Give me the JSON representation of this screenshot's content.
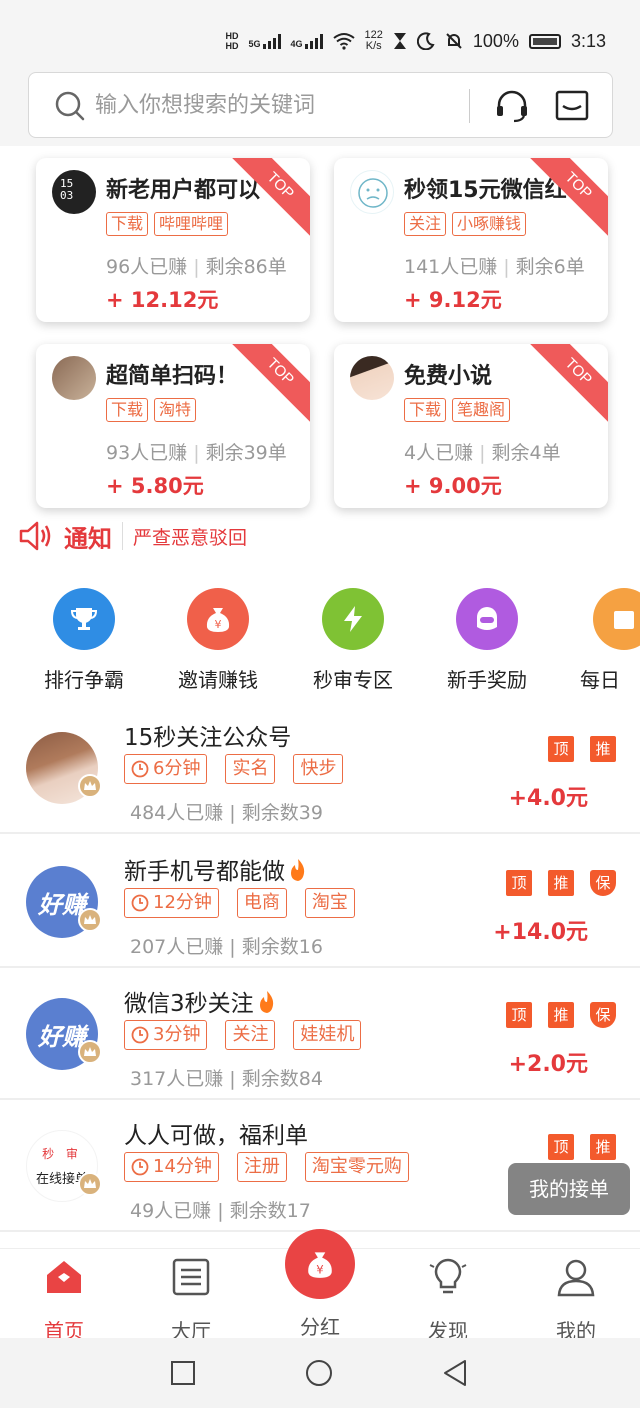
{
  "status_bar": {
    "network": "5G",
    "network2": "4G",
    "speed_value": "122",
    "speed_unit": "K/s",
    "battery": "100%",
    "time": "3:13"
  },
  "search": {
    "placeholder": "输入你想搜索的关键词"
  },
  "top_cards": [
    {
      "title": "新老用户都可以",
      "tags": [
        "下载",
        "哔哩哔哩"
      ],
      "earned": "96人已赚",
      "remaining": "剩余86单",
      "reward": "+ 12.12元",
      "ribbon": "TOP"
    },
    {
      "title": "秒领15元微信红",
      "tags": [
        "关注",
        "小啄赚钱"
      ],
      "earned": "141人已赚",
      "remaining": "剩余6单",
      "reward": "+ 9.12元",
      "ribbon": "TOP"
    },
    {
      "title": "超简单扫码！",
      "tags": [
        "下载",
        "淘特"
      ],
      "earned": "93人已赚",
      "remaining": "剩余39单",
      "reward": "+ 5.80元",
      "ribbon": "TOP"
    },
    {
      "title": "免费小说",
      "tags": [
        "下载",
        "笔趣阁"
      ],
      "earned": "4人已赚",
      "remaining": "剩余4单",
      "reward": "+ 9.00元",
      "ribbon": "TOP"
    }
  ],
  "card_avatar_text": "15\n03",
  "notice": {
    "label": "通知",
    "text": "严查恶意驳回"
  },
  "categories": [
    {
      "label": "排行争霸",
      "color": "#2f8de4"
    },
    {
      "label": "邀请赚钱",
      "color": "#f0604a"
    },
    {
      "label": "秒审专区",
      "color": "#7fc234"
    },
    {
      "label": "新手奖励",
      "color": "#b05be0"
    },
    {
      "label": "每日",
      "color": "#f5a142"
    }
  ],
  "tasks": [
    {
      "title": "15秒关注公众号",
      "time": "6分钟",
      "tags": [
        "实名",
        "快步"
      ],
      "stats": "484人已赚 | 剩余数39",
      "badges": [
        "顶",
        "推"
      ],
      "reward": "+4.0元",
      "hot": false
    },
    {
      "title": "新手机号都能做",
      "time": "12分钟",
      "tags": [
        "电商",
        "淘宝"
      ],
      "stats": "207人已赚 | 剩余数16",
      "badges": [
        "顶",
        "推",
        "保"
      ],
      "reward": "+14.0元",
      "hot": true,
      "avatar_text": "好赚"
    },
    {
      "title": "微信3秒关注",
      "time": "3分钟",
      "tags": [
        "关注",
        "娃娃机"
      ],
      "stats": "317人已赚 | 剩余数84",
      "badges": [
        "顶",
        "推",
        "保"
      ],
      "reward": "+2.0元",
      "hot": true,
      "avatar_text": "好赚"
    },
    {
      "title": "人人可做，福利单",
      "time": "14分钟",
      "tags": [
        "注册",
        "淘宝零元购"
      ],
      "stats": "49人已赚 | 剩余数17",
      "badges": [
        "顶",
        "推"
      ],
      "reward": "",
      "hot": false,
      "avatar_text_top": "秒 审",
      "avatar_text": "在线接单"
    }
  ],
  "floating_button": "我的接单",
  "bottom_nav": [
    {
      "label": "首页",
      "active": true
    },
    {
      "label": "大厅",
      "active": false
    },
    {
      "label": "分红",
      "active": false
    },
    {
      "label": "发现",
      "active": false
    },
    {
      "label": "我的",
      "active": false
    }
  ],
  "colors": {
    "accent": "#e4393c",
    "tag": "#ec6d45",
    "badge": "#f35a2c"
  }
}
